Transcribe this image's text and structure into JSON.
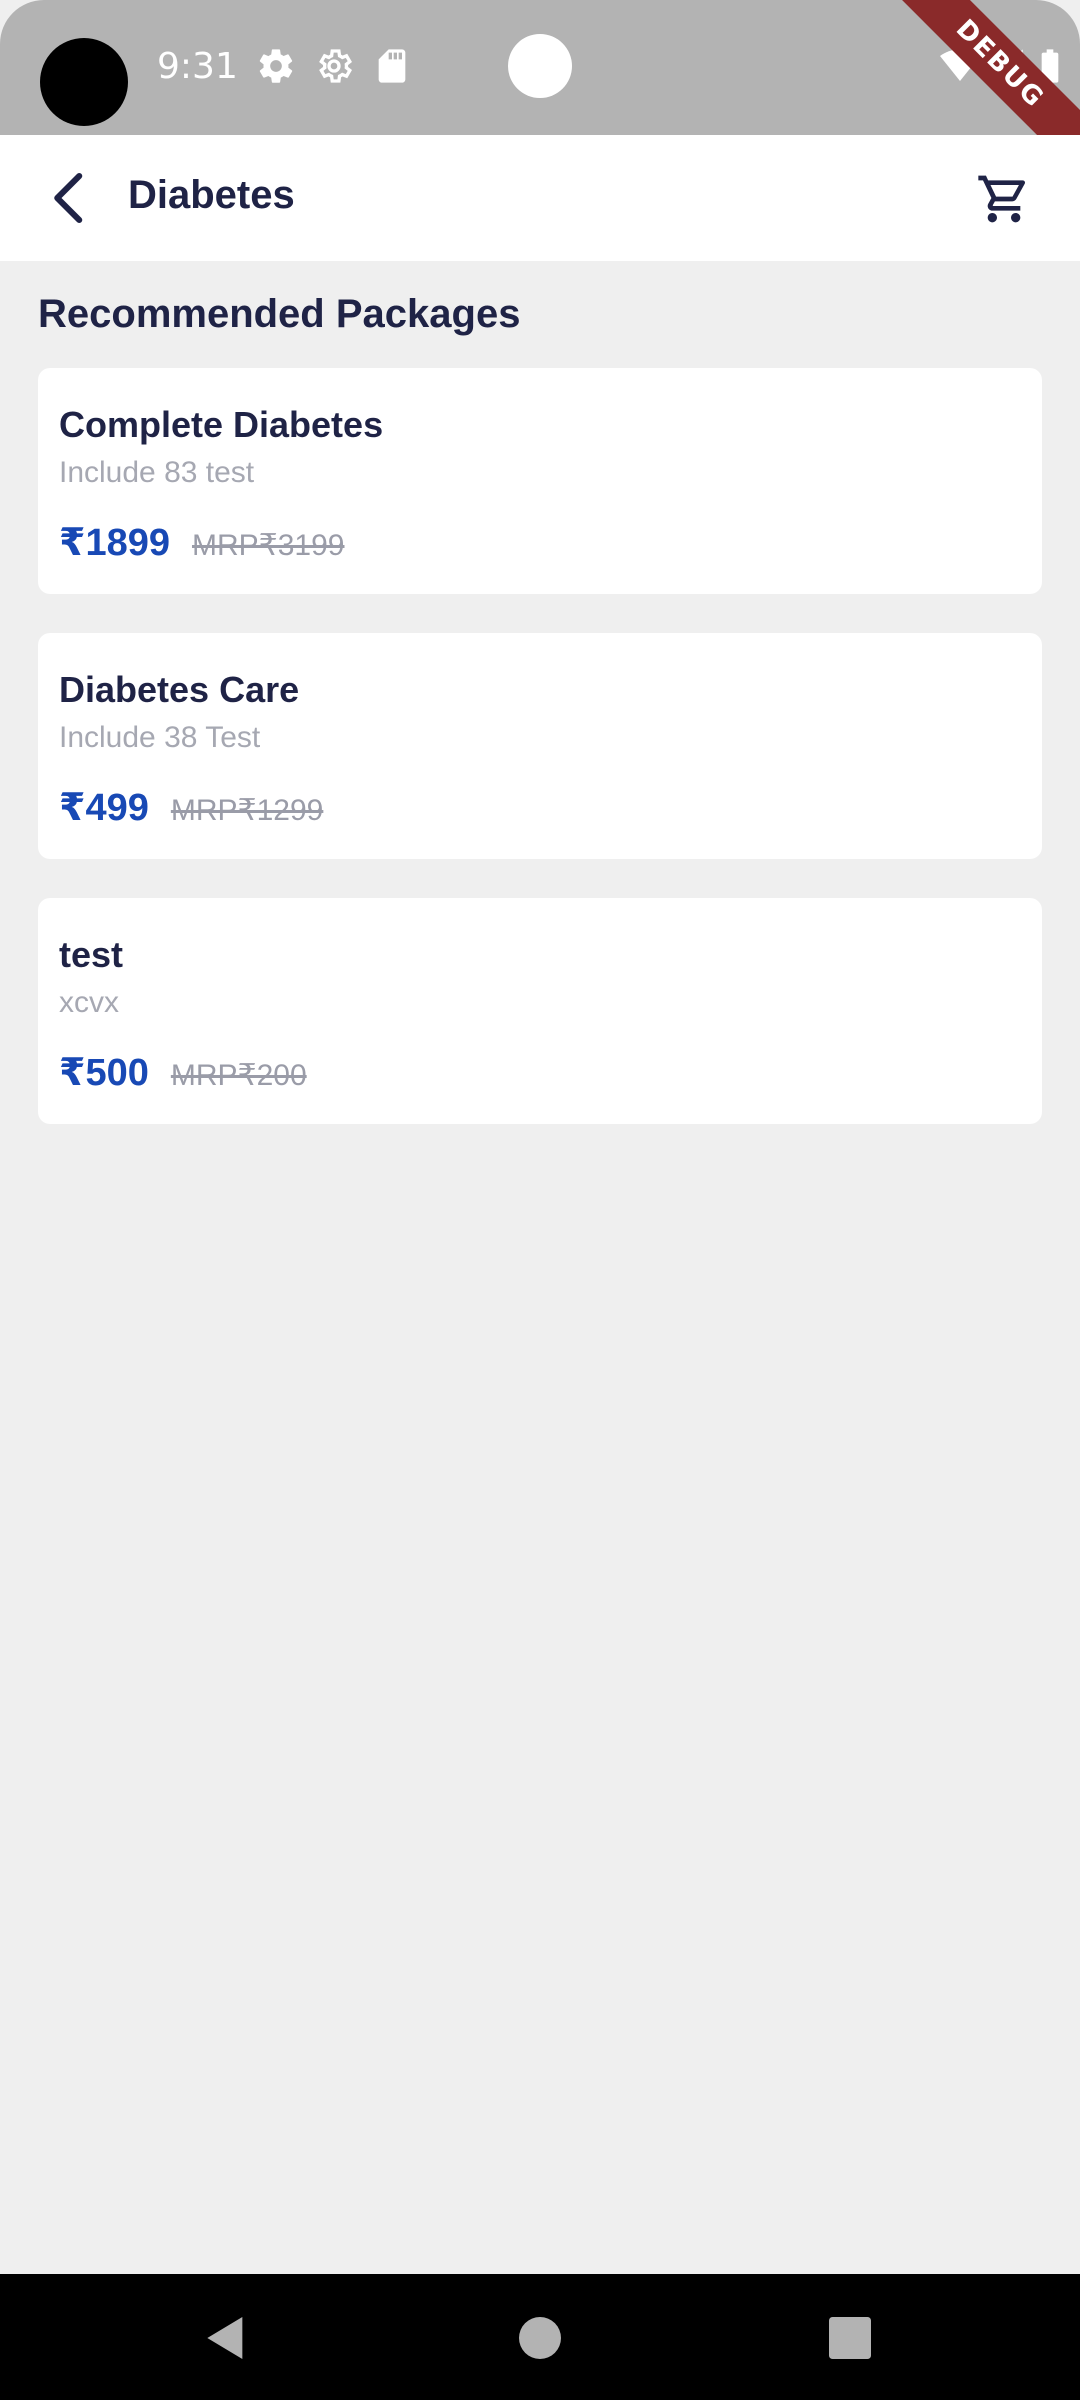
{
  "status_bar": {
    "time": "9:31",
    "debug_label": "DEBUG",
    "icons": [
      "settings-icon",
      "settings-outline-icon",
      "sd-card-icon",
      "wifi-icon",
      "signal-icon",
      "battery-icon"
    ]
  },
  "app_bar": {
    "title": "Diabetes",
    "back_icon": "back-arrow-icon",
    "cart_icon": "cart-icon"
  },
  "section": {
    "title": "Recommended Packages"
  },
  "packages": [
    {
      "name": "Complete Diabetes",
      "subtitle": "Include 83 test",
      "price": "₹1899",
      "mrp": "MRP₹3199"
    },
    {
      "name": "Diabetes Care",
      "subtitle": "Include 38 Test",
      "price": "₹499",
      "mrp": "MRP₹1299"
    },
    {
      "name": "test",
      "subtitle": "xcvx",
      "price": "₹500",
      "mrp": "MRP₹200"
    }
  ],
  "colors": {
    "primary_text": "#1f2346",
    "price": "#1849b5",
    "muted": "#a6a8b2",
    "background": "#efefef",
    "status_bar": "#b3b3b3"
  },
  "nav_bar": {
    "icons": [
      "nav-back-icon",
      "nav-home-icon",
      "nav-recents-icon"
    ]
  }
}
